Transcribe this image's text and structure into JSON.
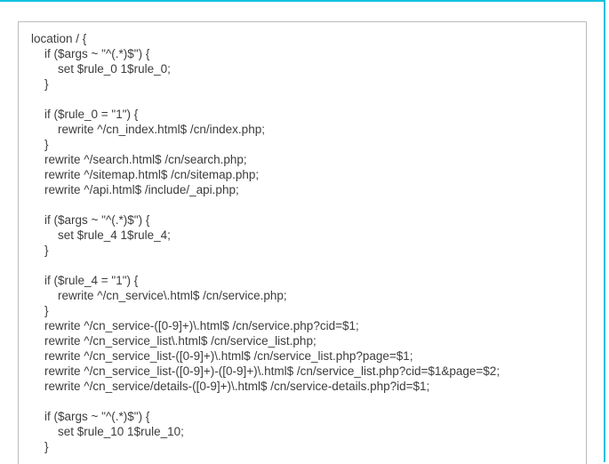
{
  "code_lines": [
    "location / {",
    "    if ($args ~ \"^(.*)$\") {",
    "        set $rule_0 1$rule_0;",
    "    }",
    "",
    "    if ($rule_0 = \"1\") {",
    "        rewrite ^/cn_index.html$ /cn/index.php;",
    "    }",
    "    rewrite ^/search.html$ /cn/search.php;",
    "    rewrite ^/sitemap.html$ /cn/sitemap.php;",
    "    rewrite ^/api.html$ /include/_api.php;",
    "",
    "    if ($args ~ \"^(.*)$\") {",
    "        set $rule_4 1$rule_4;",
    "    }",
    "",
    "    if ($rule_4 = \"1\") {",
    "        rewrite ^/cn_service\\.html$ /cn/service.php;",
    "    }",
    "    rewrite ^/cn_service-([0-9]+)\\.html$ /cn/service.php?cid=$1;",
    "    rewrite ^/cn_service_list\\.html$ /cn/service_list.php;",
    "    rewrite ^/cn_service_list-([0-9]+)\\.html$ /cn/service_list.php?page=$1;",
    "    rewrite ^/cn_service_list-([0-9]+)-([0-9]+)\\.html$ /cn/service_list.php?cid=$1&page=$2;",
    "    rewrite ^/cn_service/details-([0-9]+)\\.html$ /cn/service-details.php?id=$1;",
    "",
    "    if ($args ~ \"^(.*)$\") {",
    "        set $rule_10 1$rule_10;",
    "    }"
  ]
}
